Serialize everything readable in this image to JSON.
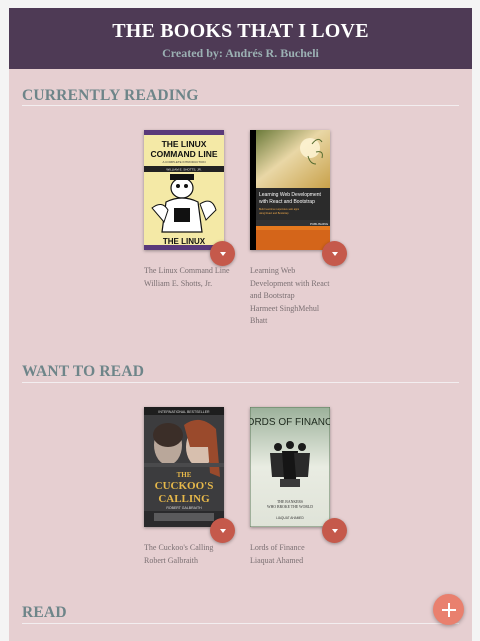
{
  "header": {
    "title": "THE BOOKS THAT I LOVE",
    "subtitle": "Created by: Andrés R. Bucheli"
  },
  "sections": [
    {
      "title": "CURRENTLY READING",
      "books": [
        {
          "title": "The Linux Command Line",
          "author": "William E. Shotts, Jr.",
          "cover": {
            "top_text": "THE LINUX COMMAND LINE",
            "subtitle": "A COMPLETE INTRODUCTION",
            "author_text": "WILLIAM E. SHOTTS, JR.",
            "bottom_text": "THE LINUX"
          }
        },
        {
          "title": "Learning Web Development with React and Bootstrap",
          "author": "Harmeet SinghMehul Bhatt",
          "cover": {
            "main_text": "Learning Web Development with React and Bootstrap",
            "sub_text": "Build real-time responsive web apps using React and Bootstrap",
            "badge": "PUBLISHING"
          }
        }
      ]
    },
    {
      "title": "WANT TO READ",
      "books": [
        {
          "title": "The Cuckoo's Calling",
          "author": "Robert Galbraith",
          "cover": {
            "top_text": "INTERNATIONAL BESTSELLER",
            "main_text": "THE CUCKOO'S CALLING",
            "sub_text": "ROBERT GALBRAITH"
          }
        },
        {
          "title": "Lords of Finance",
          "author": "Liaquat Ahamed",
          "cover": {
            "top_text": "LORDS OF FINANCE",
            "sub_text": "THE BANKERS WHO BROKE THE WORLD",
            "author_text": "LIAQUAT AHAMED"
          }
        }
      ]
    },
    {
      "title": "READ",
      "books": []
    }
  ],
  "add_button": {
    "label": "+"
  },
  "book_menu": {
    "icon": "triangle-down"
  }
}
